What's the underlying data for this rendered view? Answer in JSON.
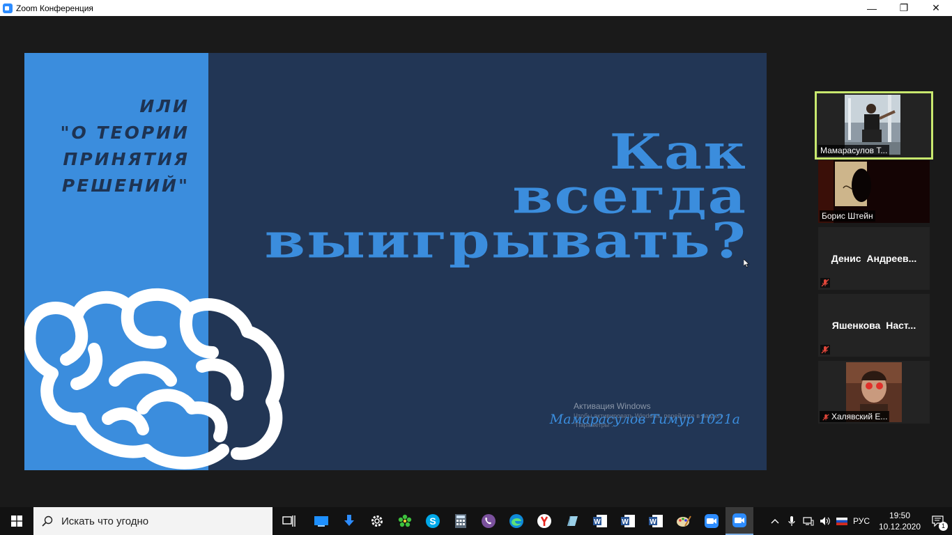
{
  "window": {
    "title": "Zoom Конференция",
    "controls": {
      "minimize": "—",
      "restore": "❐",
      "close": "✕"
    }
  },
  "slide": {
    "subtitle": "ИЛИ\n\"О ТЕОРИИ\nПРИНЯТИЯ\nРЕШЕНИЙ\"",
    "title_line1": "Как",
    "title_line2": "всегда",
    "title_line3": "выигрывать?",
    "author": "Мамарасулов Тимур 1021а",
    "colors": {
      "dark": "#223655",
      "accent": "#3b8ddd"
    }
  },
  "watermark": {
    "title": "Активация Windows",
    "line1": "Чтобы активировать Windows, перейдите в раздел",
    "line2": "\"Параметры\"."
  },
  "participants": [
    {
      "name": "Мамарасулов Т...",
      "video": true,
      "active": true,
      "muted": false
    },
    {
      "name": "Борис Штейн",
      "video": true,
      "active": false,
      "muted": false
    },
    {
      "name": "Денис Андреев...",
      "video": false,
      "active": false,
      "muted": true
    },
    {
      "name": "Яшенкова Наст...",
      "video": false,
      "active": false,
      "muted": true
    },
    {
      "name": "Халявский Е...",
      "video": true,
      "active": false,
      "muted": true
    }
  ],
  "taskbar": {
    "search_placeholder": "Искать что угодно",
    "apps": [
      "task-view-icon",
      "desktop-icon",
      "download-icon",
      "settings-icon",
      "icq-icon",
      "skype-icon",
      "calculator-icon",
      "viber-icon",
      "edge-icon",
      "yandex-icon",
      "notes-icon",
      "word-icon",
      "word-icon",
      "word-icon",
      "paint-icon",
      "zoom-icon",
      "zoom-active-icon"
    ],
    "language": "РУС",
    "time": "19:50",
    "date": "10.12.2020",
    "notification_count": "1"
  }
}
